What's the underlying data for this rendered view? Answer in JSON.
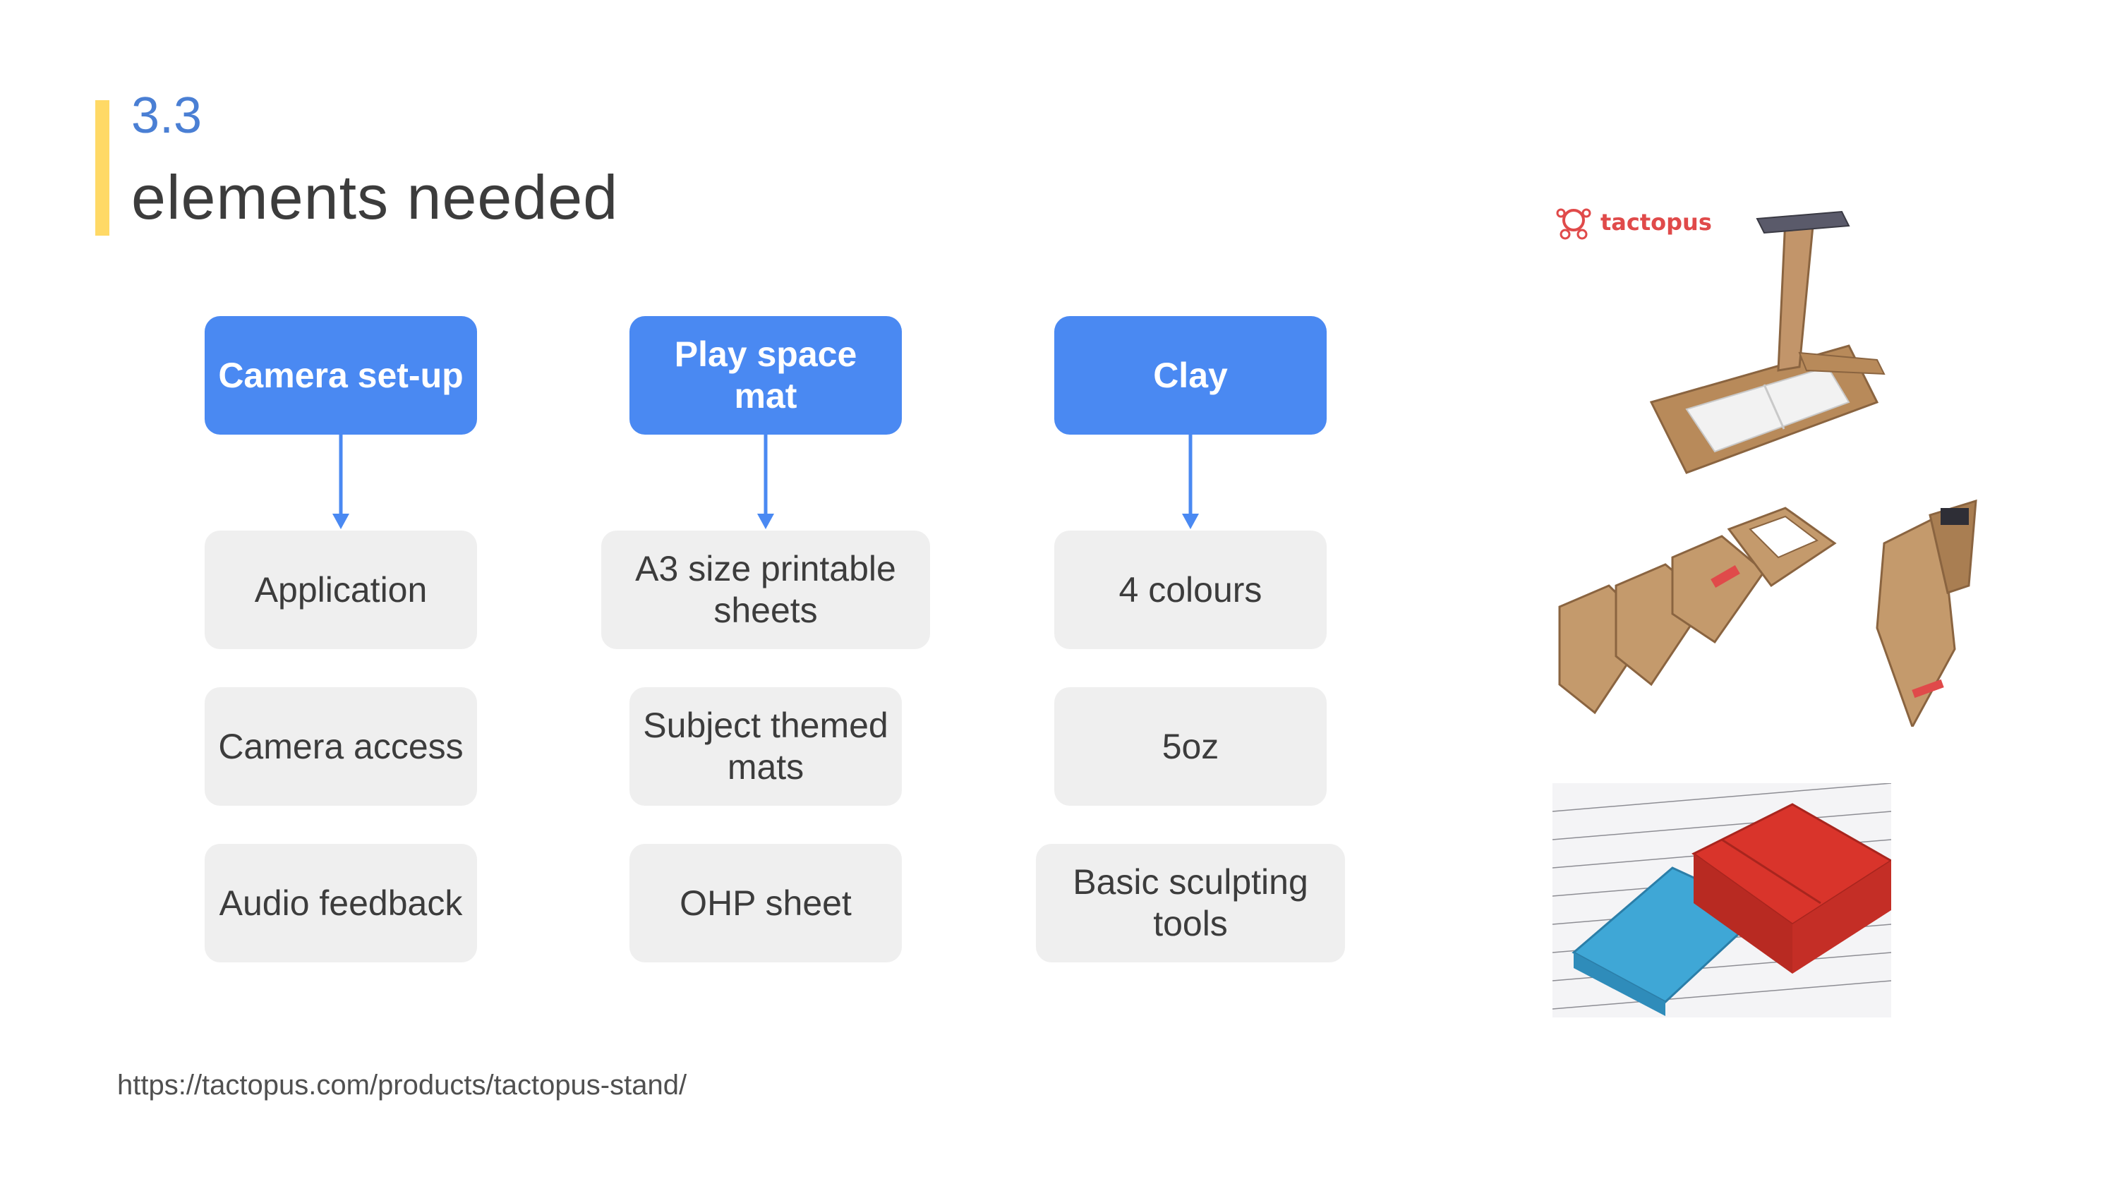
{
  "slide": {
    "number": "3.3",
    "title": "elements needed",
    "source_url": "https://tactopus.com/products/tactopus-stand/"
  },
  "columns": [
    {
      "heading": "Camera set-up",
      "items": [
        "Application",
        "Camera access",
        "Audio feedback"
      ]
    },
    {
      "heading": "Play space mat",
      "items": [
        "A3 size printable sheets",
        "Subject themed mats",
        "OHP sheet"
      ]
    },
    {
      "heading": "Clay",
      "items": [
        "4 colours",
        "5oz",
        "Basic sculpting tools"
      ]
    }
  ],
  "photos": {
    "logo_text": "tactopus"
  },
  "colors": {
    "accent": "#FFD966",
    "heading_box": "#4A89F2",
    "item_box": "#EFEFEF",
    "section_number": "#4A7FD4",
    "logo": "#E04A4A"
  }
}
